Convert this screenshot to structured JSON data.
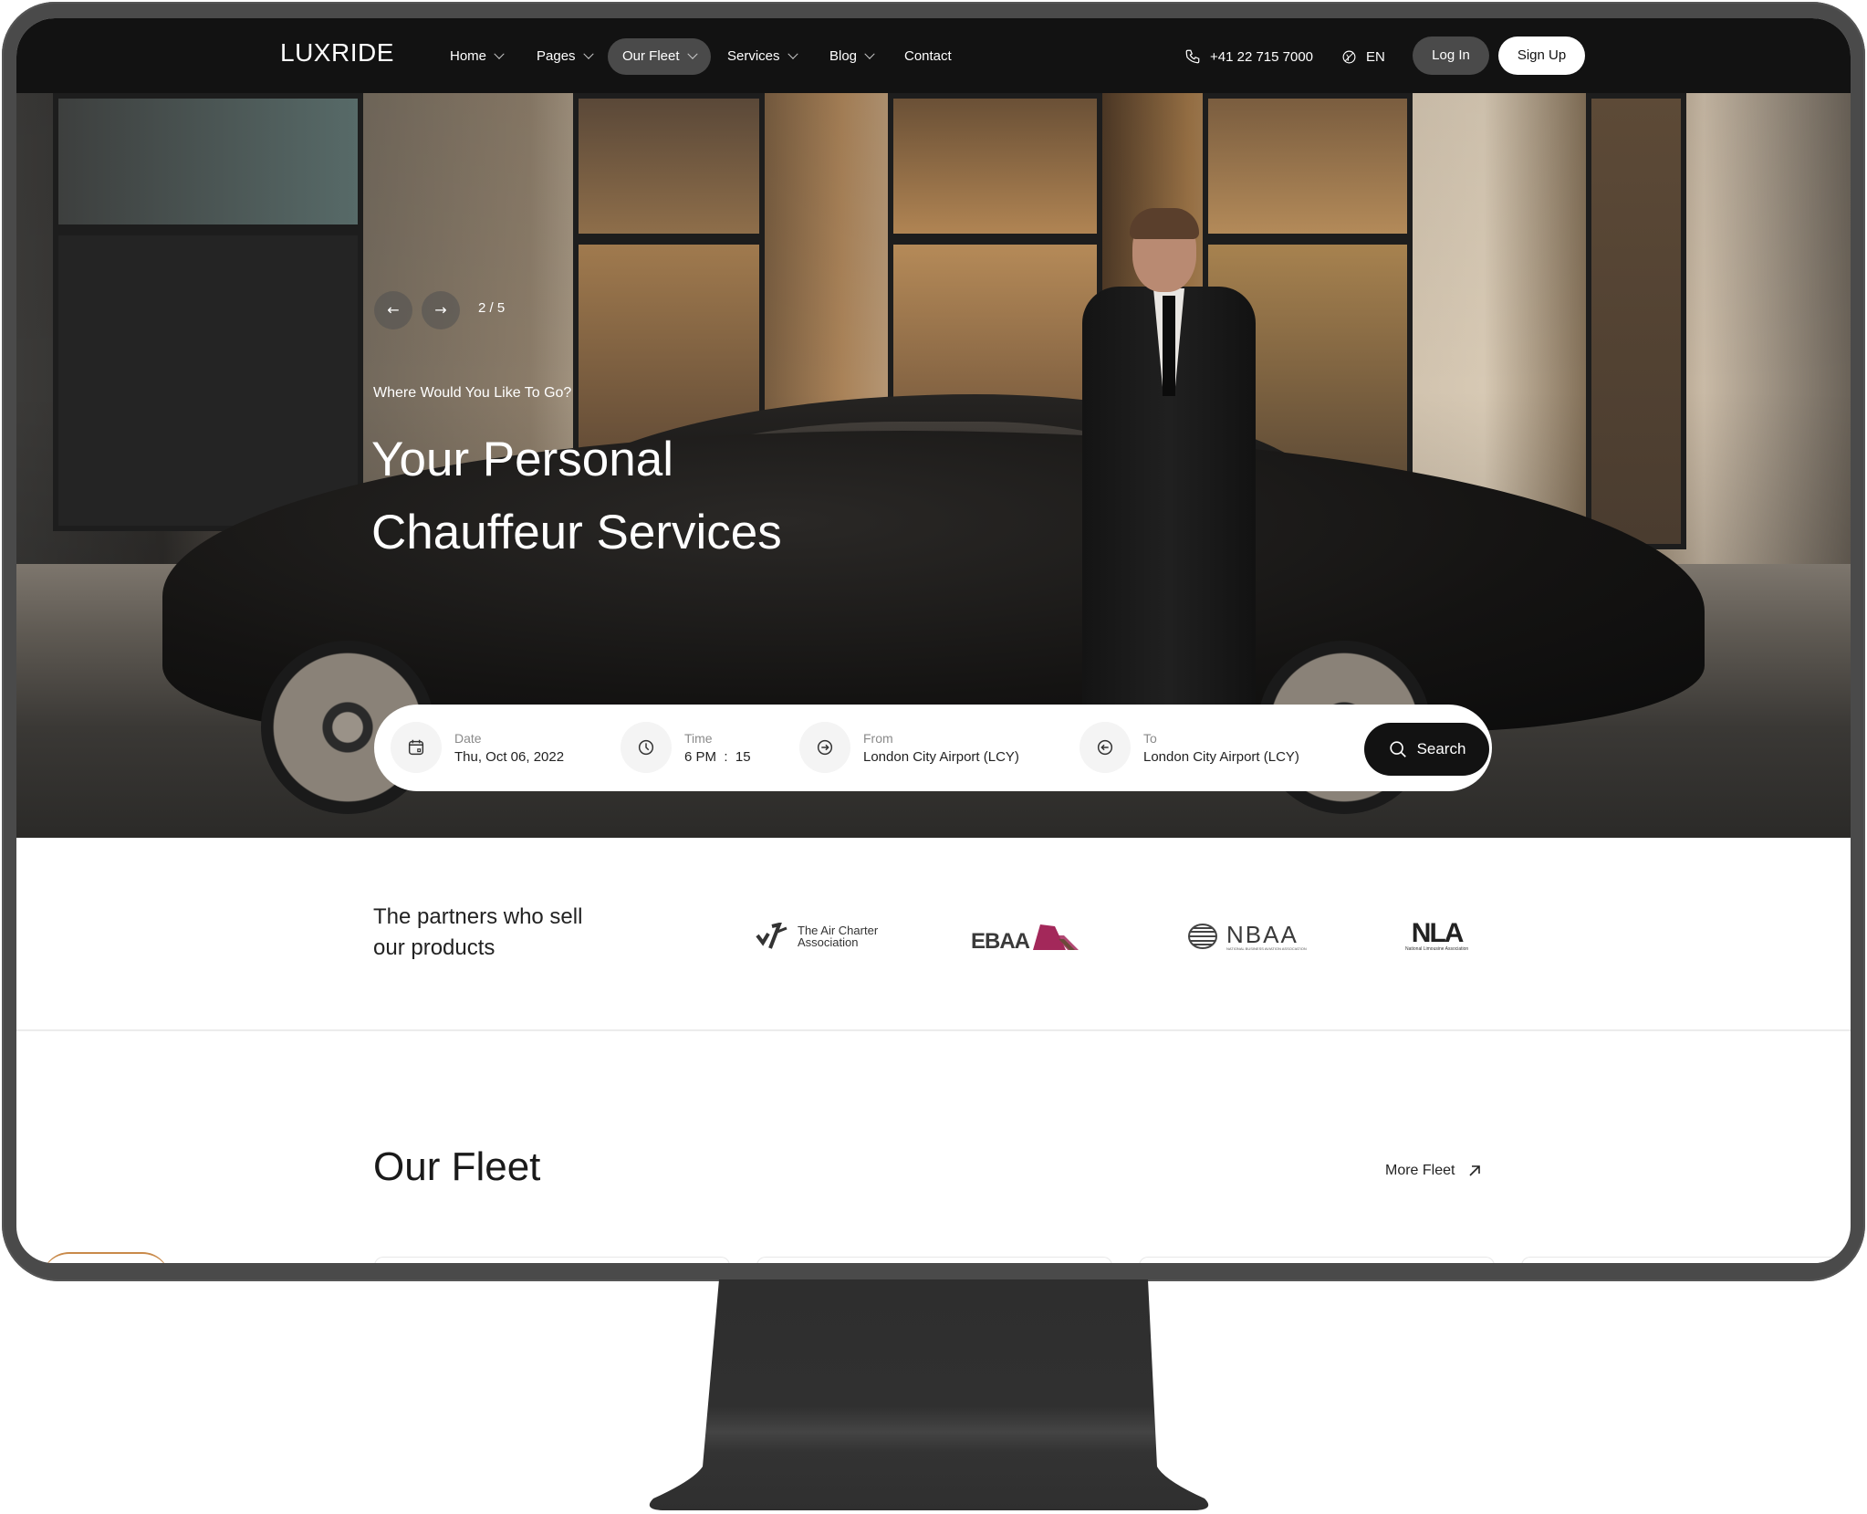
{
  "nav": {
    "logo": "LUXRIDE",
    "items": [
      {
        "label": "Home",
        "has_dropdown": true
      },
      {
        "label": "Pages",
        "has_dropdown": true
      },
      {
        "label": "Our Fleet",
        "has_dropdown": true,
        "active": true
      },
      {
        "label": "Services",
        "has_dropdown": true
      },
      {
        "label": "Blog",
        "has_dropdown": true
      },
      {
        "label": "Contact",
        "has_dropdown": false
      }
    ],
    "phone": "+41 22 715 7000",
    "language": "EN",
    "login_label": "Log In",
    "signup_label": "Sign Up"
  },
  "hero": {
    "slide_counter": "2 / 5",
    "prev_icon": "arrow-left-icon",
    "next_icon": "arrow-right-icon",
    "subtitle": "Where Would You Like To Go?",
    "title_line1": "Your Personal",
    "title_line2": "Chauffeur Services"
  },
  "search": {
    "fields": [
      {
        "label": "Date",
        "value": "Thu, Oct 06, 2022",
        "icon": "calendar-icon"
      },
      {
        "label": "Time",
        "value": "6 PM  :  15",
        "icon": "clock-icon"
      },
      {
        "label": "From",
        "value": "London City Airport (LCY)",
        "icon": "location-from-icon"
      },
      {
        "label": "To",
        "value": "London City Airport (LCY)",
        "icon": "location-to-icon"
      }
    ],
    "button_label": "Search"
  },
  "partners": {
    "heading_line1": "The partners who sell",
    "heading_line2": "our products",
    "logos": [
      {
        "name": "The Air Charter Association",
        "line1": "The Air Charter",
        "line2": "Association"
      },
      {
        "name": "EBAA",
        "text": "EBAA",
        "accent": "#a3285a"
      },
      {
        "name": "NBAA",
        "text": "NBAA",
        "subtext": "NATIONAL BUSINESS AVIATION ASSOCIATION"
      },
      {
        "name": "NLA",
        "text": "NLA",
        "subtext": "National Limousine Association"
      }
    ]
  },
  "fleet": {
    "title": "Our Fleet",
    "more_label": "More Fleet"
  },
  "colors": {
    "nav_bg": "#121212",
    "active_pill": "#4a4a4a",
    "bezel": "#4a4a4a",
    "stand": "#333333",
    "ebaa_accent": "#a3285a"
  }
}
